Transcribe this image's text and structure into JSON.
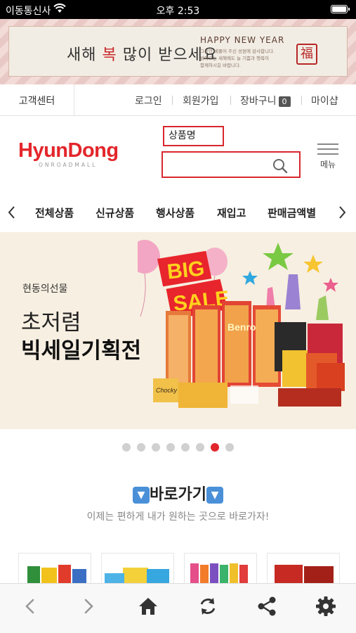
{
  "status_bar": {
    "carrier": "이동통신사",
    "time": "오후 2:53"
  },
  "new_year_banner": {
    "main_text_1": "새해 ",
    "main_text_red": "복",
    "main_text_2": " 많이 받으세요",
    "happy_text": "HAPPY NEW YEAR",
    "message_lines": [
      "그동안 베풀어 주신 성원에 감사합니다.",
      "밝아오는 새해에도 늘 기쁨과 행복이",
      "함께하시길 바랍니다."
    ],
    "seal_char": "福"
  },
  "top_links": {
    "customer_center": "고객센터",
    "login": "로그인",
    "signup": "회원가입",
    "cart": "장바구니",
    "cart_count": "0",
    "my_shop": "마이샵"
  },
  "header": {
    "logo_text": "HyunDong",
    "logo_sub": "ONROADMALL",
    "search_label": "상품명",
    "search_value": "",
    "menu_label": "메뉴"
  },
  "category_nav": {
    "items": [
      "전체상품",
      "신규상품",
      "행사상품",
      "재입고",
      "판매금액별"
    ]
  },
  "hero": {
    "brand": "현동의선물",
    "subtitle": "초저렴",
    "title": "빅세일기획전",
    "badge_line1": "BIG",
    "badge_line2": "SALE",
    "product_text": "Benro",
    "snack_text": "Chocky"
  },
  "carousel": {
    "total": 8,
    "active_index": 6
  },
  "shortcut": {
    "title": "바로가기",
    "description": "이제는 편하게 내가 원하는 곳으로 바로가자!"
  },
  "colors": {
    "brand_red": "#e3262b",
    "hero_bg": "#f7efe1",
    "dot_inactive": "#d0d0d0"
  },
  "bottom_bar": {
    "icons": [
      "back-icon",
      "forward-icon",
      "home-icon",
      "refresh-icon",
      "share-icon",
      "settings-icon"
    ]
  }
}
